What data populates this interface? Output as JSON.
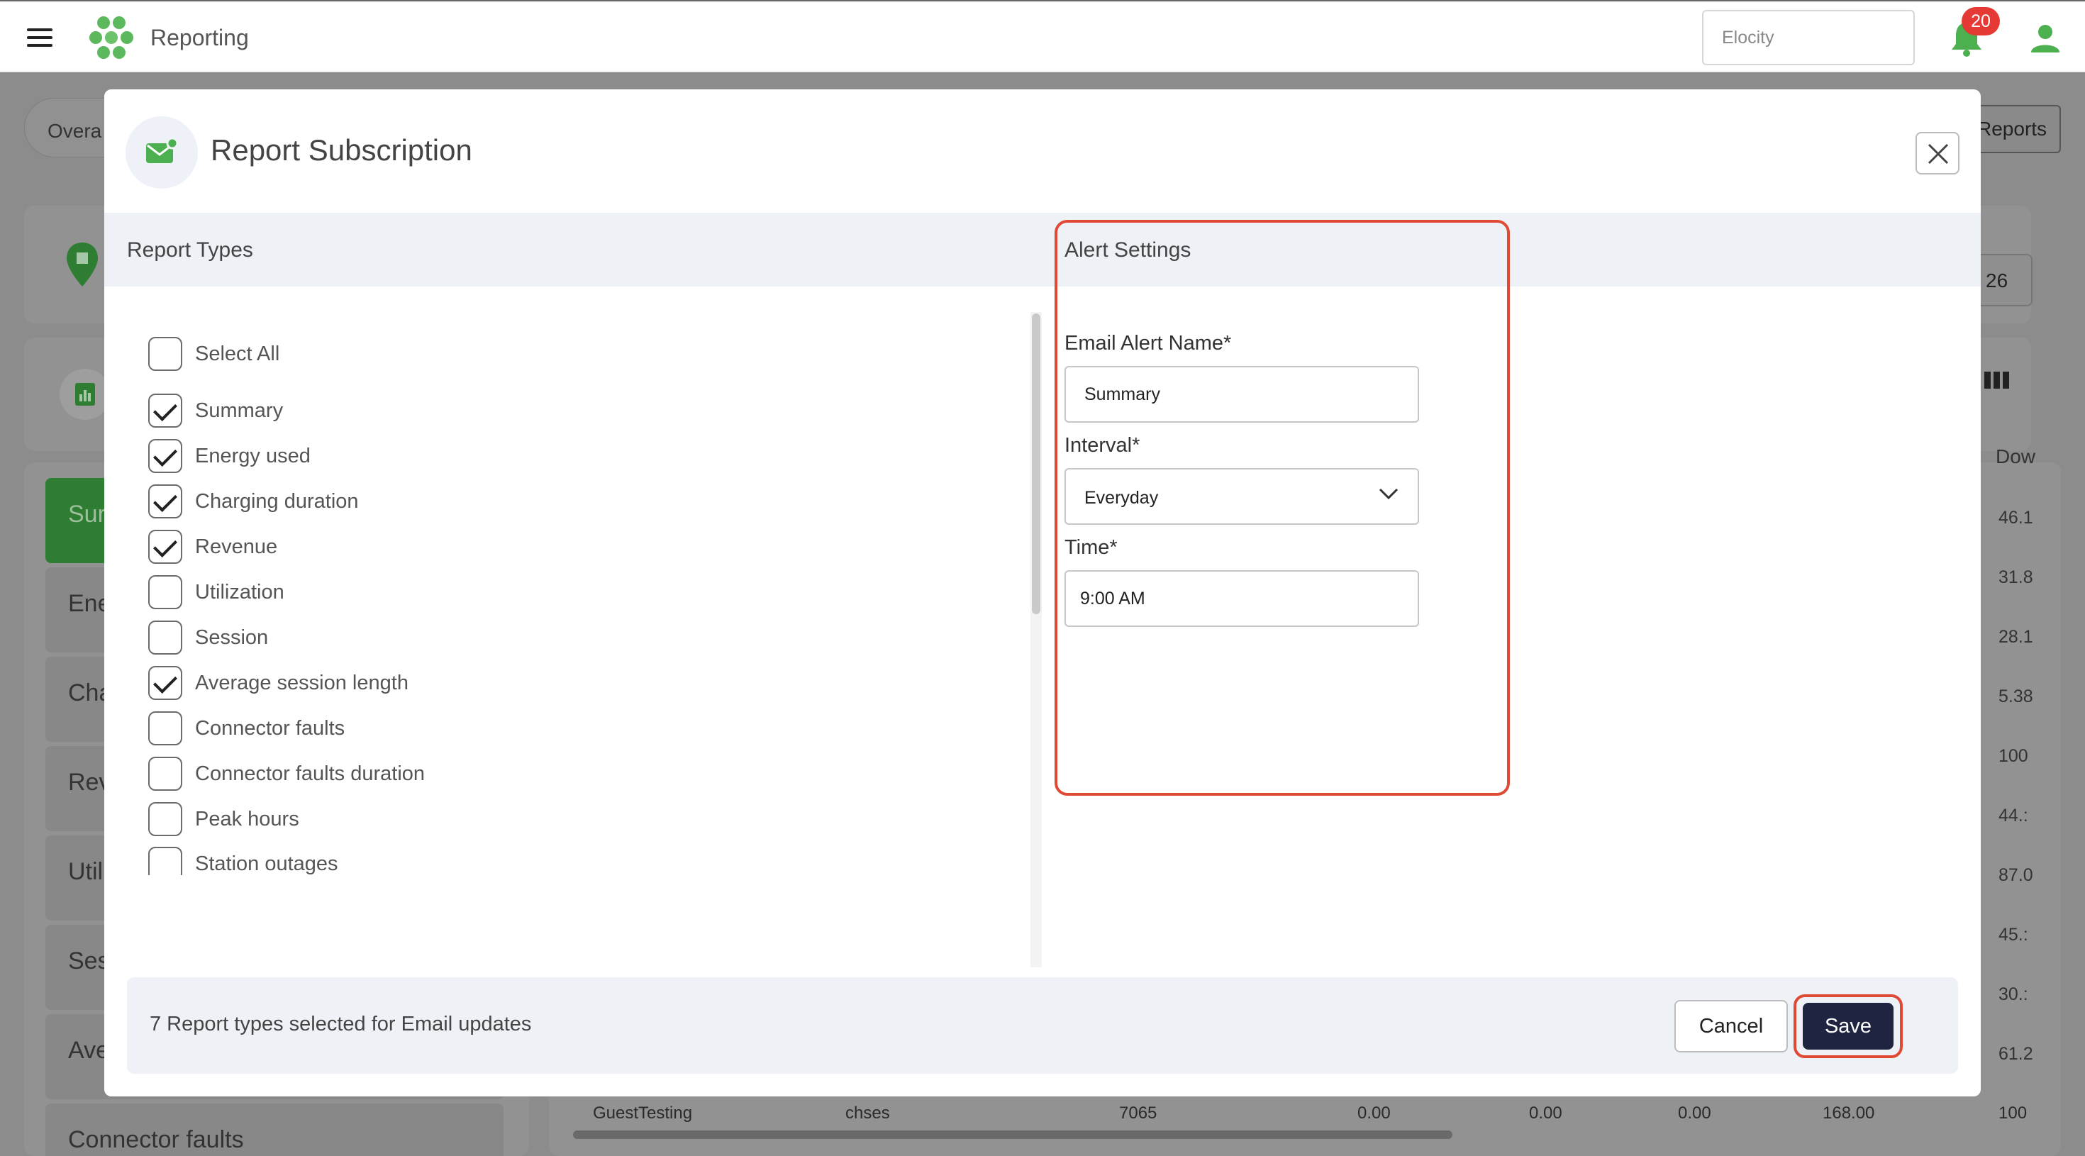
{
  "topbar": {
    "title": "Reporting",
    "search_value": "Elocity",
    "notification_count": "20",
    "icons": {
      "menu": "hamburger-icon",
      "logo": "hexagon-cluster-logo",
      "bell": "bell-icon",
      "user": "user-icon"
    },
    "colors": {
      "brand_green": "#4caf50",
      "badge_red": "#e53935"
    }
  },
  "background": {
    "tab_partial": "Overa",
    "reports_button_partial": "Reports",
    "date_partial": "l 26",
    "column_header_partial": "Dow",
    "side_items": [
      "Sur",
      "Ene",
      "Cha",
      "Rev",
      "Util",
      "Ses",
      "Ave",
      "Connector faults"
    ],
    "right_values": [
      "46.1",
      "31.8",
      "28.1",
      "5.38",
      "100",
      "44.:",
      "87.0",
      "45.:",
      "30.:",
      "61.2"
    ],
    "table_row": [
      "GuestTesting",
      "chses",
      "7065",
      "0.00",
      "0.00",
      "0.00",
      "168.00",
      "100"
    ]
  },
  "modal": {
    "title": "Report Subscription",
    "icon": "mail-icon",
    "report_types_header": "Report Types",
    "alert_settings_header": "Alert Settings",
    "select_all": {
      "label": "Select All",
      "checked": false
    },
    "report_types": [
      {
        "label": "Summary",
        "checked": true
      },
      {
        "label": "Energy used",
        "checked": true
      },
      {
        "label": "Charging duration",
        "checked": true
      },
      {
        "label": "Revenue",
        "checked": true
      },
      {
        "label": "Utilization",
        "checked": false
      },
      {
        "label": "Session",
        "checked": false
      },
      {
        "label": "Average session length",
        "checked": true
      },
      {
        "label": "Connector faults",
        "checked": false
      },
      {
        "label": "Connector faults duration",
        "checked": false
      },
      {
        "label": "Peak hours",
        "checked": false
      },
      {
        "label": "Station outages",
        "checked": false
      }
    ],
    "alert": {
      "name_label": "Email Alert Name*",
      "name_value": "Summary",
      "interval_label": "Interval*",
      "interval_value": "Everyday",
      "time_label": "Time*",
      "time_value": "9:00 AM"
    },
    "footer_text": "7 Report types selected for Email updates",
    "cancel_label": "Cancel",
    "save_label": "Save",
    "colors": {
      "save_bg": "#1f2540",
      "highlight": "#e04a35",
      "section_bg": "#eef1f6"
    }
  }
}
